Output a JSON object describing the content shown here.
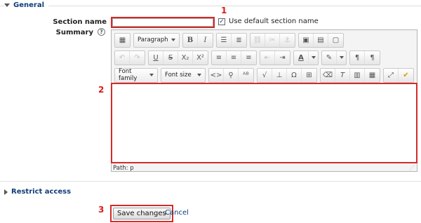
{
  "general": {
    "title": "General"
  },
  "annotations": {
    "n1": "1",
    "n2": "2",
    "n3": "3"
  },
  "section_name": {
    "label": "Section name",
    "value": "",
    "use_default_label": "Use default section name",
    "use_default_checked": true
  },
  "summary": {
    "label": "Summary",
    "help_glyph": "?"
  },
  "editor": {
    "paragraph_select": "Paragraph",
    "font_family_select": "Font family",
    "font_size_select": "Font size",
    "path": "Path: p"
  },
  "restrict": {
    "title": "Restrict access"
  },
  "buttons": {
    "save": "Save changes",
    "cancel": "Cancel"
  },
  "colors": {
    "annotation": "#d42a2a",
    "link": "#0f3c7a"
  }
}
